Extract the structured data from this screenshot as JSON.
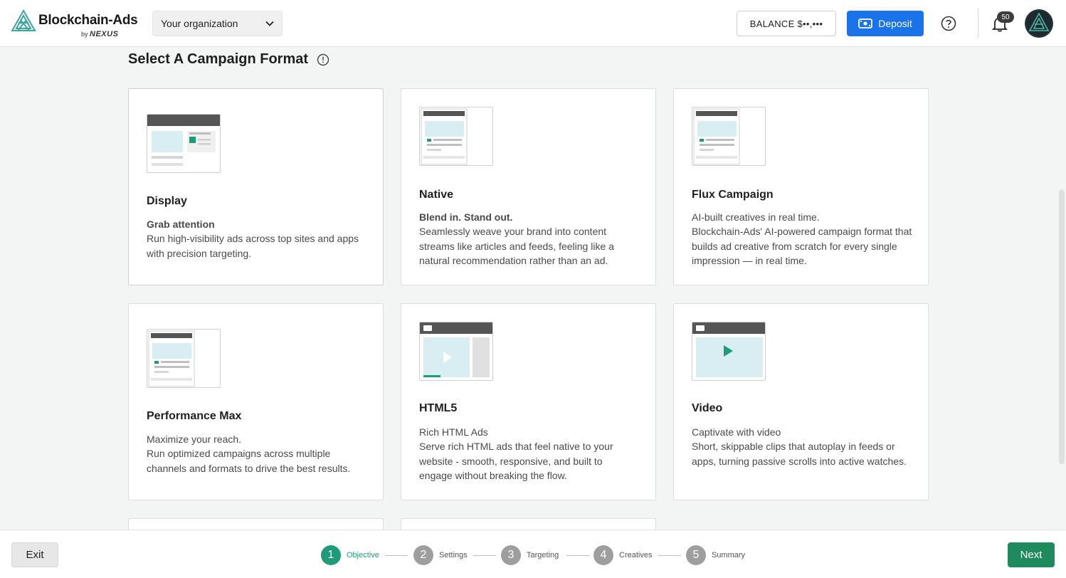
{
  "header": {
    "logo_text": "Blockchain-Ads",
    "logo_by": "by",
    "logo_nexus": "NEXUS",
    "org_select_value": "Your organization",
    "balance_label": "BALANCE $••,•••",
    "deposit_label": "Deposit",
    "notifications_count": "50"
  },
  "main": {
    "title": "Select A Campaign Format",
    "cards": [
      {
        "title": "Display",
        "tagline": "Grab attention",
        "description": "Run high-visibility ads across top sites and apps with precision targeting."
      },
      {
        "title": "Native",
        "tagline": "Blend in. Stand out.",
        "description": "Seamlessly weave your brand into content streams like articles and feeds, feeling like a natural recommendation rather than an ad."
      },
      {
        "title": "Flux Campaign",
        "tagline": "AI-built creatives in real time.",
        "description": "Blockchain-Ads' AI-powered campaign format that builds ad creative from scratch for every single impression — in real time."
      },
      {
        "title": "Performance Max",
        "tagline": "Maximize your reach.",
        "description": "Run optimized campaigns across multiple channels and formats to drive the best results."
      },
      {
        "title": "HTML5",
        "tagline": "Rich HTML Ads",
        "description": "Serve rich HTML ads that feel native to your website - smooth, responsive, and built to engage without breaking the flow."
      },
      {
        "title": "Video",
        "tagline": "Captivate with video",
        "description": "Short, skippable clips that autoplay in feeds or apps, turning passive scrolls into active watches."
      }
    ]
  },
  "footer": {
    "exit_label": "Exit",
    "next_label": "Next",
    "steps": [
      {
        "num": "1",
        "label": "Objective"
      },
      {
        "num": "2",
        "label": "Settings"
      },
      {
        "num": "3",
        "label": "Targeting"
      },
      {
        "num": "4",
        "label": "Creatives"
      },
      {
        "num": "5",
        "label": "Summary"
      }
    ]
  },
  "colors": {
    "accent_green": "#1f9b7a",
    "next_green": "#1f8a5b",
    "deposit_blue": "#1a73e8",
    "thumb_teal": "#d9eef2"
  }
}
